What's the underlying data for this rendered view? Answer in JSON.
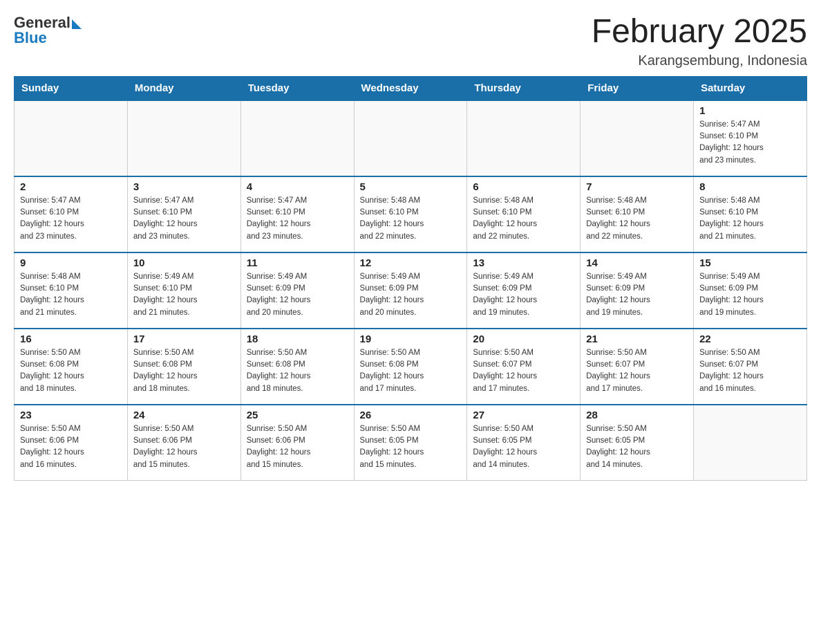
{
  "header": {
    "logo_general": "General",
    "logo_blue": "Blue",
    "month_title": "February 2025",
    "location": "Karangsembung, Indonesia"
  },
  "weekdays": [
    "Sunday",
    "Monday",
    "Tuesday",
    "Wednesday",
    "Thursday",
    "Friday",
    "Saturday"
  ],
  "weeks": [
    {
      "days": [
        {
          "number": "",
          "info": ""
        },
        {
          "number": "",
          "info": ""
        },
        {
          "number": "",
          "info": ""
        },
        {
          "number": "",
          "info": ""
        },
        {
          "number": "",
          "info": ""
        },
        {
          "number": "",
          "info": ""
        },
        {
          "number": "1",
          "info": "Sunrise: 5:47 AM\nSunset: 6:10 PM\nDaylight: 12 hours\nand 23 minutes."
        }
      ]
    },
    {
      "days": [
        {
          "number": "2",
          "info": "Sunrise: 5:47 AM\nSunset: 6:10 PM\nDaylight: 12 hours\nand 23 minutes."
        },
        {
          "number": "3",
          "info": "Sunrise: 5:47 AM\nSunset: 6:10 PM\nDaylight: 12 hours\nand 23 minutes."
        },
        {
          "number": "4",
          "info": "Sunrise: 5:47 AM\nSunset: 6:10 PM\nDaylight: 12 hours\nand 23 minutes."
        },
        {
          "number": "5",
          "info": "Sunrise: 5:48 AM\nSunset: 6:10 PM\nDaylight: 12 hours\nand 22 minutes."
        },
        {
          "number": "6",
          "info": "Sunrise: 5:48 AM\nSunset: 6:10 PM\nDaylight: 12 hours\nand 22 minutes."
        },
        {
          "number": "7",
          "info": "Sunrise: 5:48 AM\nSunset: 6:10 PM\nDaylight: 12 hours\nand 22 minutes."
        },
        {
          "number": "8",
          "info": "Sunrise: 5:48 AM\nSunset: 6:10 PM\nDaylight: 12 hours\nand 21 minutes."
        }
      ]
    },
    {
      "days": [
        {
          "number": "9",
          "info": "Sunrise: 5:48 AM\nSunset: 6:10 PM\nDaylight: 12 hours\nand 21 minutes."
        },
        {
          "number": "10",
          "info": "Sunrise: 5:49 AM\nSunset: 6:10 PM\nDaylight: 12 hours\nand 21 minutes."
        },
        {
          "number": "11",
          "info": "Sunrise: 5:49 AM\nSunset: 6:09 PM\nDaylight: 12 hours\nand 20 minutes."
        },
        {
          "number": "12",
          "info": "Sunrise: 5:49 AM\nSunset: 6:09 PM\nDaylight: 12 hours\nand 20 minutes."
        },
        {
          "number": "13",
          "info": "Sunrise: 5:49 AM\nSunset: 6:09 PM\nDaylight: 12 hours\nand 19 minutes."
        },
        {
          "number": "14",
          "info": "Sunrise: 5:49 AM\nSunset: 6:09 PM\nDaylight: 12 hours\nand 19 minutes."
        },
        {
          "number": "15",
          "info": "Sunrise: 5:49 AM\nSunset: 6:09 PM\nDaylight: 12 hours\nand 19 minutes."
        }
      ]
    },
    {
      "days": [
        {
          "number": "16",
          "info": "Sunrise: 5:50 AM\nSunset: 6:08 PM\nDaylight: 12 hours\nand 18 minutes."
        },
        {
          "number": "17",
          "info": "Sunrise: 5:50 AM\nSunset: 6:08 PM\nDaylight: 12 hours\nand 18 minutes."
        },
        {
          "number": "18",
          "info": "Sunrise: 5:50 AM\nSunset: 6:08 PM\nDaylight: 12 hours\nand 18 minutes."
        },
        {
          "number": "19",
          "info": "Sunrise: 5:50 AM\nSunset: 6:08 PM\nDaylight: 12 hours\nand 17 minutes."
        },
        {
          "number": "20",
          "info": "Sunrise: 5:50 AM\nSunset: 6:07 PM\nDaylight: 12 hours\nand 17 minutes."
        },
        {
          "number": "21",
          "info": "Sunrise: 5:50 AM\nSunset: 6:07 PM\nDaylight: 12 hours\nand 17 minutes."
        },
        {
          "number": "22",
          "info": "Sunrise: 5:50 AM\nSunset: 6:07 PM\nDaylight: 12 hours\nand 16 minutes."
        }
      ]
    },
    {
      "days": [
        {
          "number": "23",
          "info": "Sunrise: 5:50 AM\nSunset: 6:06 PM\nDaylight: 12 hours\nand 16 minutes."
        },
        {
          "number": "24",
          "info": "Sunrise: 5:50 AM\nSunset: 6:06 PM\nDaylight: 12 hours\nand 15 minutes."
        },
        {
          "number": "25",
          "info": "Sunrise: 5:50 AM\nSunset: 6:06 PM\nDaylight: 12 hours\nand 15 minutes."
        },
        {
          "number": "26",
          "info": "Sunrise: 5:50 AM\nSunset: 6:05 PM\nDaylight: 12 hours\nand 15 minutes."
        },
        {
          "number": "27",
          "info": "Sunrise: 5:50 AM\nSunset: 6:05 PM\nDaylight: 12 hours\nand 14 minutes."
        },
        {
          "number": "28",
          "info": "Sunrise: 5:50 AM\nSunset: 6:05 PM\nDaylight: 12 hours\nand 14 minutes."
        },
        {
          "number": "",
          "info": ""
        }
      ]
    }
  ]
}
